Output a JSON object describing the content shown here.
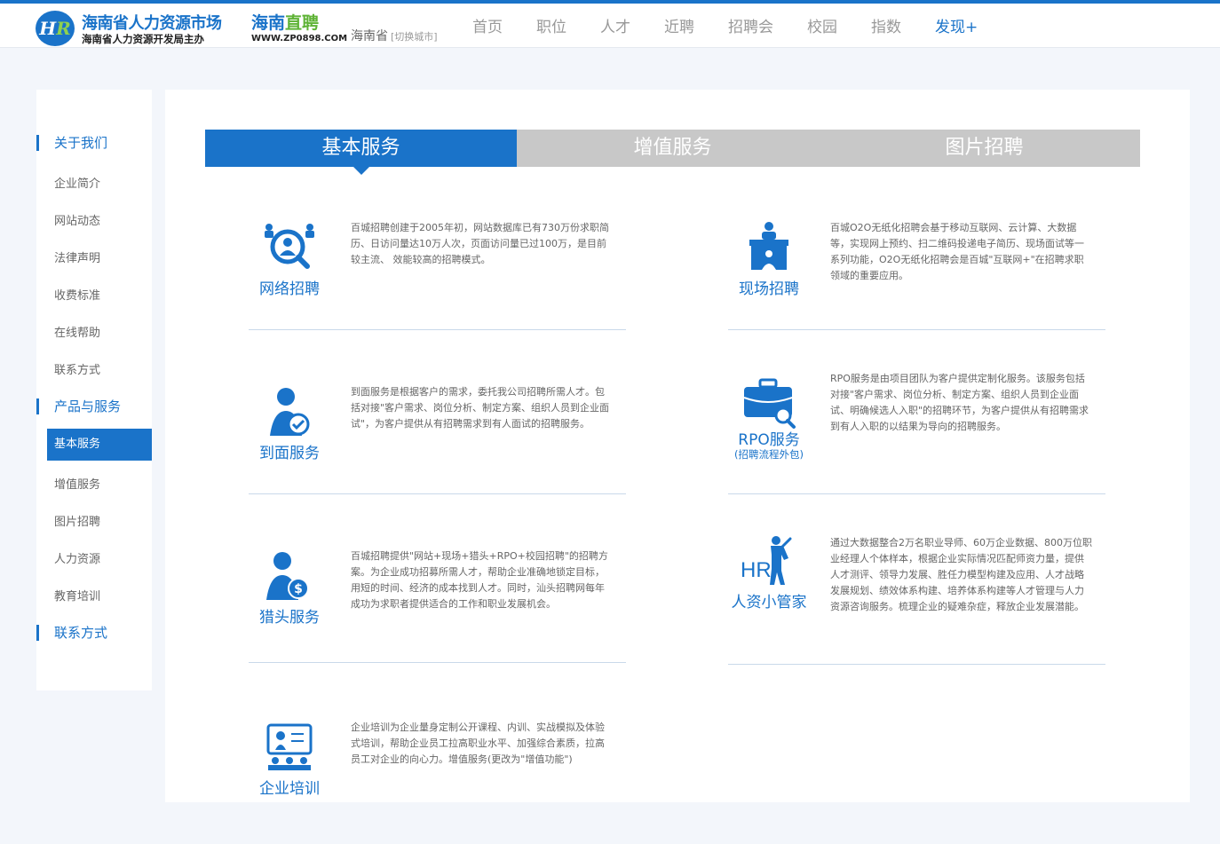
{
  "header": {
    "logo_badge": "HR",
    "logo_main": "海南省人力资源市场",
    "logo_brand_a": "海南",
    "logo_brand_b": "直聘",
    "logo_sub": "海南省人力资源开发局主办",
    "logo_url": "WWW.ZP0898.COM",
    "city": "海南省",
    "city_switch": "[切换城市]",
    "nav": [
      "首页",
      "职位",
      "人才",
      "近聘",
      "招聘会",
      "校园",
      "指数",
      "发现+"
    ],
    "nav_active_index": 7
  },
  "sidebar": {
    "sections": [
      {
        "title": "关于我们",
        "items": [
          "企业简介",
          "网站动态",
          "法律声明",
          "收费标准",
          "在线帮助",
          "联系方式"
        ]
      },
      {
        "title": "产品与服务",
        "items": [
          "基本服务",
          "增值服务",
          "图片招聘",
          "人力资源",
          "教育培训"
        ]
      },
      {
        "title": "联系方式",
        "items": []
      }
    ],
    "active_item": "基本服务"
  },
  "tabs": [
    "基本服务",
    "增值服务",
    "图片招聘"
  ],
  "active_tab": 0,
  "services": [
    {
      "icon": "network-recruit-icon",
      "title": "网络招聘",
      "subtitle": "",
      "desc": "百城招聘创建于2005年初，网站数据库已有730万份求职简历、日访问量达10万人次，页面访问量已过100万，是目前较主流、 效能较高的招聘模式。"
    },
    {
      "icon": "onsite-recruit-icon",
      "title": "现场招聘",
      "subtitle": "",
      "desc": "百城O2O无纸化招聘会基于移动互联网、云计算、大数据等，实现网上预约、扫二维码投递电子简历、现场面试等一系列功能，O2O无纸化招聘会是百城\"互联网+\"在招聘求职领域的重要应用。"
    },
    {
      "icon": "door-service-icon",
      "title": "到面服务",
      "subtitle": "",
      "desc": "到面服务是根据客户的需求，委托我公司招聘所需人才。包括对接\"客户需求、岗位分析、制定方案、组织人员到企业面试\"，为客户提供从有招聘需求到有人面试的招聘服务。"
    },
    {
      "icon": "briefcase-search-icon",
      "title": "RPO服务",
      "subtitle": "(招聘流程外包)",
      "desc": "RPO服务是由项目团队为客户提供定制化服务。该服务包括对接\"客户需求、岗位分析、制定方案、组织人员到企业面试、明确候选人入职\"的招聘环节，为客户提供从有招聘需求到有人入职的以结果为导向的招聘服务。"
    },
    {
      "icon": "headhunter-icon",
      "title": "猎头服务",
      "subtitle": "",
      "desc": "百城招聘提供\"网站+现场+猎头+RPO+校园招聘\"的招聘方案。为企业成功招募所需人才，帮助企业准确地锁定目标，用短的时间、经济的成本找到人才。同时，汕头招聘网每年成功为求职者提供适合的工作和职业发展机会。"
    },
    {
      "icon": "hr-manager-icon",
      "title": "人资小管家",
      "subtitle": "",
      "icon_text": "HR",
      "desc": "通过大数据整合2万名职业导师、60万企业数据、800万位职业经理人个体样本，根据企业实际情况匹配师资力量，提供人才测评、领导力发展、胜任力模型构建及应用、人才战略发展规划、绩效体系构建、培养体系构建等人才管理与人力资源咨询服务。梳理企业的疑难杂症，释放企业发展潜能。"
    },
    {
      "icon": "training-icon",
      "title": "企业培训",
      "subtitle": "",
      "desc": "企业培训为企业量身定制公开课程、内训、实战模拟及体验式培训，帮助企业员工拉高职业水平、加强综合素质，拉高员工对企业的向心力。增值服务(更改为\"增值功能\")"
    }
  ],
  "colors": {
    "primary": "#1a73c9",
    "tab_inactive": "#c8c8c8",
    "brand_green": "#5fb336"
  }
}
